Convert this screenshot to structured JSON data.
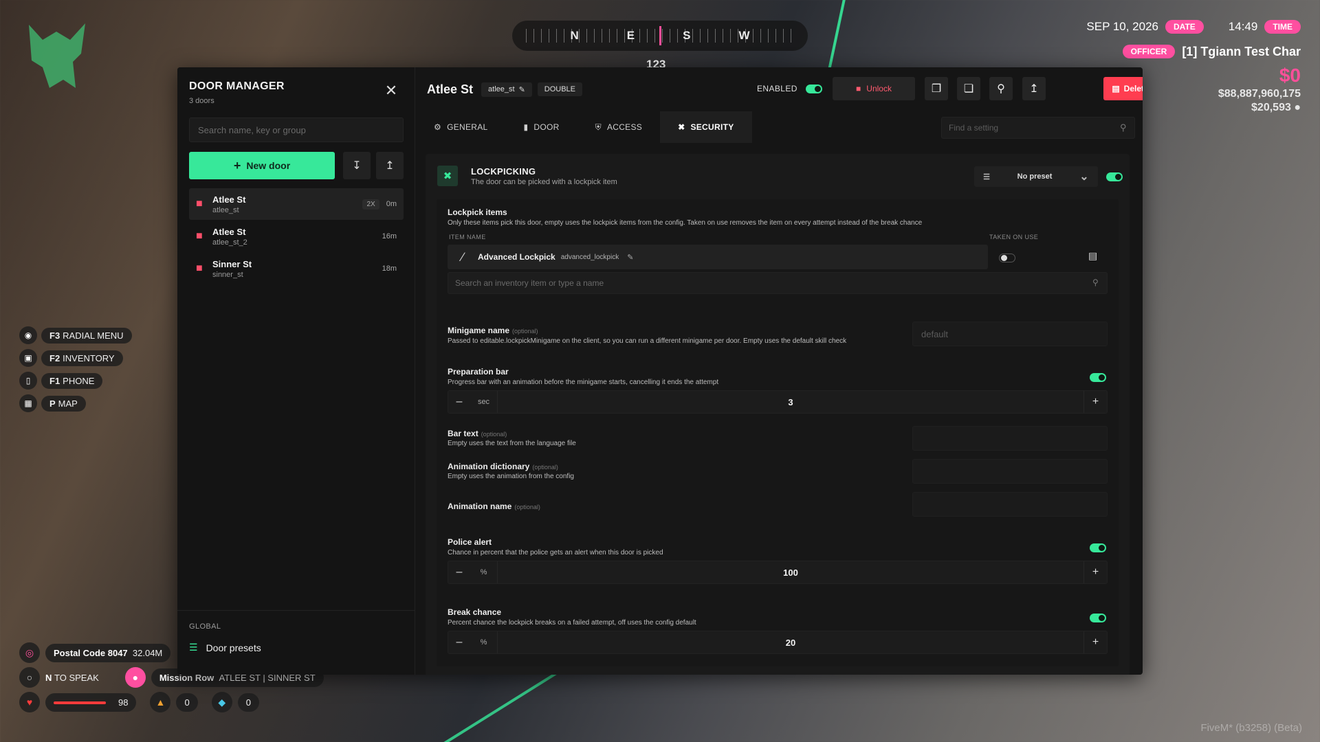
{
  "hud": {
    "compass": [
      "N",
      "E",
      "S",
      "W"
    ],
    "heading": "123",
    "date": "SEP 10, 2026",
    "date_pill": "DATE",
    "time": "14:49",
    "time_pill": "TIME",
    "job_pill": "OFFICER",
    "player": "[1] Tgiann Test Char",
    "cash": "$0",
    "bank": "$88,887,960,175",
    "dirty": "$20,593",
    "keybinds": [
      {
        "key": "F3",
        "label": "RADIAL MENU",
        "icon": "radial-icon"
      },
      {
        "key": "F2",
        "label": "INVENTORY",
        "icon": "bag-icon"
      },
      {
        "key": "F1",
        "label": "PHONE",
        "icon": "phone-icon"
      },
      {
        "key": "P",
        "label": "MAP",
        "icon": "map-icon"
      }
    ],
    "postal": "Postal Code 8047",
    "postal_distance": "32.04M",
    "speak_key": "N",
    "speak_label": "TO SPEAK",
    "location_area": "Mission Row",
    "location_streets": "ATLEE ST | SINNER ST",
    "health": "98",
    "stamina": "0",
    "thirst": "0",
    "watermark": "FiveM* (b3258) (Beta)"
  },
  "sidebar": {
    "title": "DOOR MANAGER",
    "subtitle": "3 doors",
    "search_placeholder": "Search name, key or group",
    "new_door": "New door",
    "doors": [
      {
        "name": "Atlee St",
        "key": "atlee_st",
        "badge": "2X",
        "time": "0m"
      },
      {
        "name": "Atlee St",
        "key": "atlee_st_2",
        "badge": "",
        "time": "16m"
      },
      {
        "name": "Sinner St",
        "key": "sinner_st",
        "badge": "",
        "time": "18m"
      }
    ],
    "global_label": "GLOBAL",
    "presets_label": "Door presets"
  },
  "header": {
    "title": "Atlee St",
    "key_chip": "atlee_st",
    "type_chip": "DOUBLE",
    "enabled_label": "ENABLED",
    "unlock_label": "Unlock",
    "delete_label": "Delete door"
  },
  "tabs": [
    {
      "label": "GENERAL",
      "icon": "gear-icon"
    },
    {
      "label": "DOOR",
      "icon": "door-icon"
    },
    {
      "label": "ACCESS",
      "icon": "shield-icon"
    },
    {
      "label": "SECURITY",
      "icon": "tools-icon"
    }
  ],
  "find_placeholder": "Find a setting",
  "lockpicking": {
    "title": "LOCKPICKING",
    "desc": "The door can be picked with a lockpick item",
    "preset": "No preset",
    "items_title": "Lockpick items",
    "items_desc": "Only these items pick this door, empty uses the lockpick items from the config. Taken on use removes the item on every attempt instead of the break chance",
    "col_item": "ITEM NAME",
    "col_taken": "TAKEN ON USE",
    "item_name": "Advanced Lockpick",
    "item_key": "advanced_lockpick",
    "inv_placeholder": "Search an inventory item or type a name",
    "optional": "(optional)",
    "minigame_title": "Minigame name",
    "minigame_desc": "Passed to editable.lockpickMinigame on the client, so you can run a different minigame per door. Empty uses the default skill check",
    "minigame_placeholder": "default",
    "prep_title": "Preparation bar",
    "prep_desc": "Progress bar with an animation before the minigame starts, cancelling it ends the attempt",
    "prep_unit": "sec",
    "prep_value": "3",
    "bartext_title": "Bar text",
    "bartext_desc": "Empty uses the text from the language file",
    "animdict_title": "Animation dictionary",
    "animdict_desc": "Empty uses the animation from the config",
    "animname_title": "Animation name",
    "police_title": "Police alert",
    "police_desc": "Chance in percent that the police gets an alert when this door is picked",
    "police_unit": "%",
    "police_value": "100",
    "break_title": "Break chance",
    "break_desc": "Percent chance the lockpick breaks on a failed attempt, off uses the config default",
    "break_unit": "%",
    "break_value": "20"
  },
  "colors": {
    "accent": "#37e89a",
    "danger": "#ff3d50",
    "pink": "#ff4fa0"
  }
}
